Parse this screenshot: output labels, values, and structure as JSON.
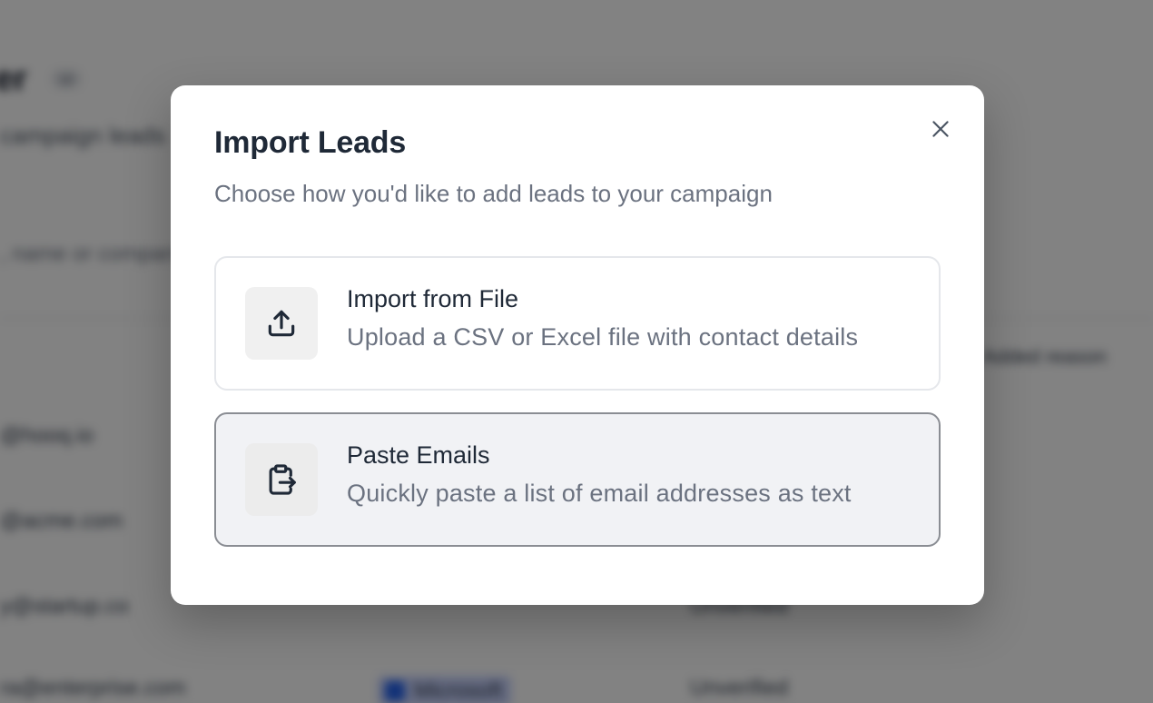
{
  "background": {
    "page_title": "er",
    "count_badge": "12",
    "subtitle": "campaign leads",
    "search_placeholder": ", name or company",
    "column_header": "Added reason",
    "rows": [
      {
        "email": "@hooq.io",
        "badge": "",
        "status": ""
      },
      {
        "email": "@acme.com",
        "badge": "",
        "status": ""
      },
      {
        "email": "y@startup.co",
        "badge": "",
        "status": "Unverified"
      },
      {
        "email": "ra@enterprise.com",
        "badge": "Microsoft",
        "status": "Unverified"
      }
    ]
  },
  "modal": {
    "title": "Import Leads",
    "description": "Choose how you'd like to add leads to your campaign",
    "close_icon": "close-icon",
    "options": [
      {
        "icon": "upload-icon",
        "title": "Import from File",
        "description": "Upload a CSV or Excel file with contact details",
        "selected": false
      },
      {
        "icon": "clipboard-export-icon",
        "title": "Paste Emails",
        "description": "Quickly paste a list of email addresses as text",
        "selected": true
      }
    ]
  },
  "colors": {
    "backdrop": "rgba(0,0,0,0.49)",
    "title": "#1f2937",
    "muted": "#6b7280",
    "selected_bg": "#f1f2f5",
    "selected_border": "#8a8d93"
  }
}
